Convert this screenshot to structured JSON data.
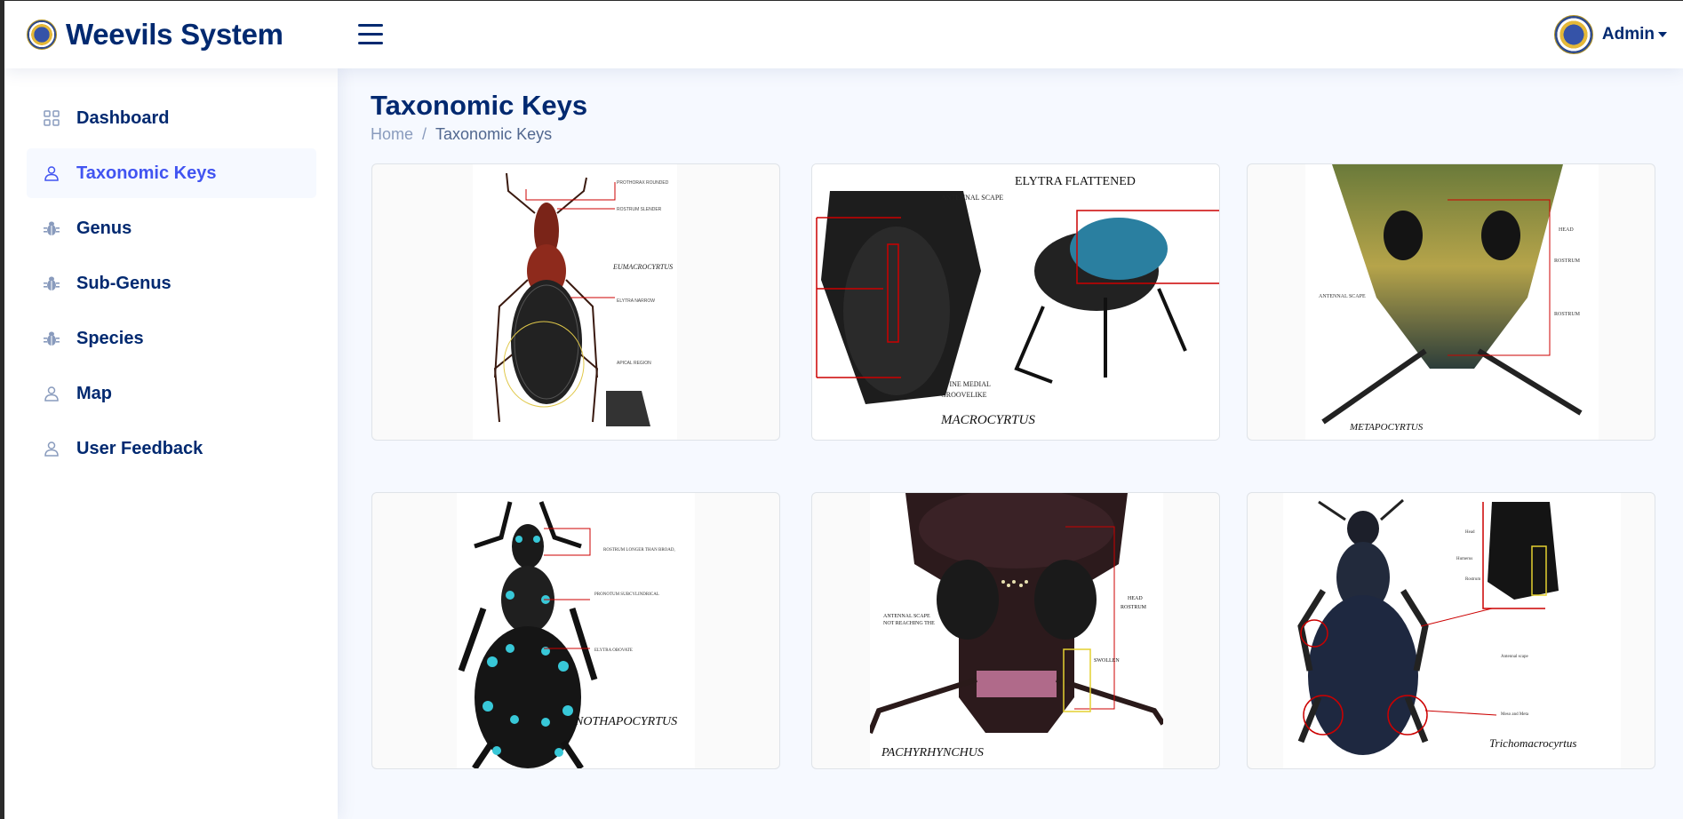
{
  "app": {
    "title": "Weevils System"
  },
  "header": {
    "profile_name": "Admin"
  },
  "sidebar": {
    "items": [
      {
        "label": "Dashboard",
        "icon": "grid-icon",
        "active": false
      },
      {
        "label": "Taxonomic Keys",
        "icon": "person-icon",
        "active": true
      },
      {
        "label": "Genus",
        "icon": "bug-icon",
        "active": false
      },
      {
        "label": "Sub-Genus",
        "icon": "bug-icon",
        "active": false
      },
      {
        "label": "Species",
        "icon": "bug-icon",
        "active": false
      },
      {
        "label": "Map",
        "icon": "person-icon",
        "active": false
      },
      {
        "label": "User Feedback",
        "icon": "person-icon",
        "active": false
      }
    ]
  },
  "main": {
    "title": "Taxonomic Keys",
    "breadcrumb": {
      "home": "Home",
      "current": "Taxonomic Keys"
    },
    "cards": [
      {
        "caption": "EUMACROCYRTUS"
      },
      {
        "caption": "MACROCYRTUS",
        "heading": "ELYTRA FLATTENED"
      },
      {
        "caption": "METAPOCYRTUS"
      },
      {
        "caption": "NOTHAPOCYRTUS"
      },
      {
        "caption": "PACHYRHYNCHUS"
      },
      {
        "caption": "Trichomacrocyrtus"
      }
    ]
  },
  "colors": {
    "brand": "#012970",
    "accent": "#4154f1",
    "muted": "#899bbd",
    "background": "#f6f9ff"
  }
}
